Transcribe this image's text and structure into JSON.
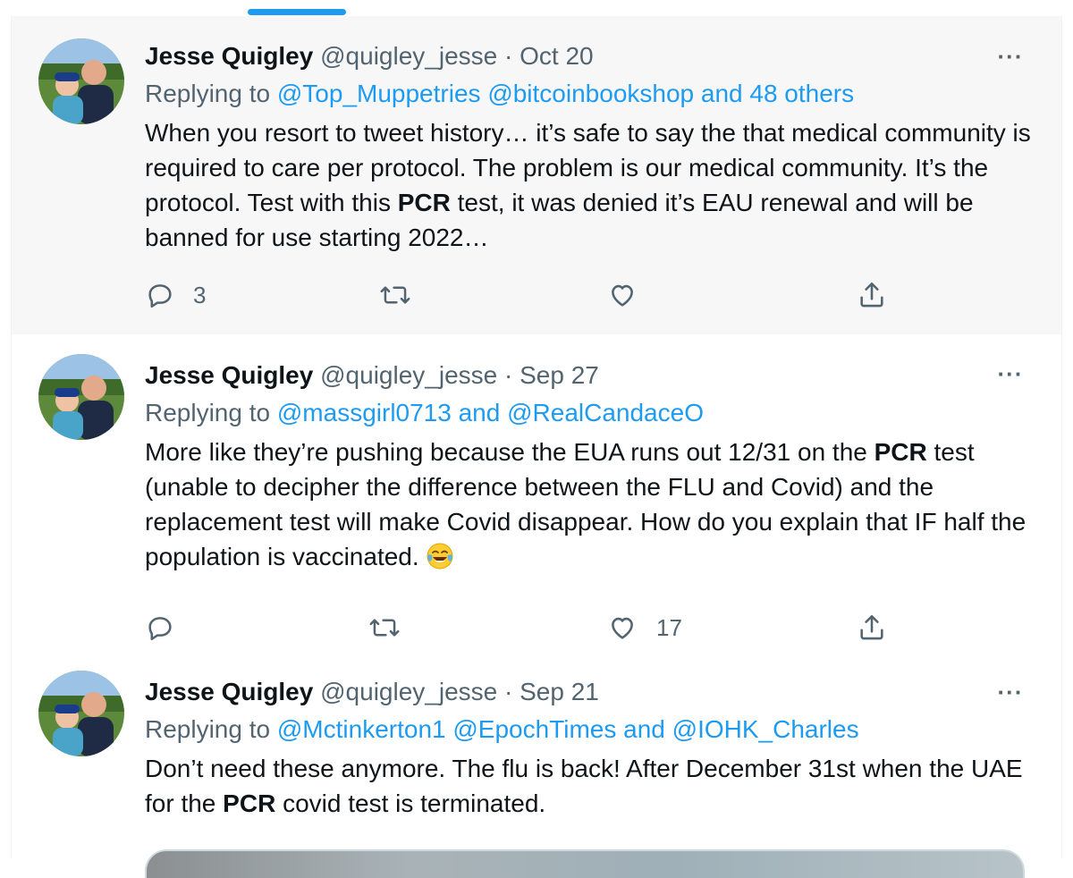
{
  "colors": {
    "accent": "#1d9bf0",
    "secondary_text": "#536471",
    "text": "#0f1419",
    "highlight_bg": "#f7f7f7"
  },
  "tweets": [
    {
      "name": "Jesse Quigley",
      "handle": "@quigley_jesse",
      "sep": "·",
      "date": "Oct 20",
      "replying_prefix": "Replying to",
      "mentions": [
        "@Top_Muppetries",
        "@bitcoinbookshop"
      ],
      "replying_suffix": "and 48 others",
      "text_parts": [
        "When you resort to tweet history… it’s safe to say the that medical community is required to care per protocol. The problem is our medical community. It’s the protocol. Test with this ",
        "PCR",
        " test, it was denied it’s EAU renewal and will be banned for use starting 2022…"
      ],
      "reply_count": "3",
      "retweet_count": "",
      "like_count": ""
    },
    {
      "name": "Jesse Quigley",
      "handle": "@quigley_jesse",
      "sep": "·",
      "date": "Sep 27",
      "replying_prefix": "Replying to",
      "mentions": [
        "@massgirl0713",
        "@RealCandaceO"
      ],
      "replying_joiner": "and",
      "text_parts": [
        "More like they’re pushing because the EUA runs out 12/31 on the ",
        "PCR",
        " test (unable to decipher the difference between the FLU and Covid) and the replacement test will make Covid disappear. How do you explain that IF half the population is vaccinated. "
      ],
      "emoji": "face-with-tears-of-joy",
      "reply_count": "",
      "retweet_count": "",
      "like_count": "17"
    },
    {
      "name": "Jesse Quigley",
      "handle": "@quigley_jesse",
      "sep": "·",
      "date": "Sep 21",
      "replying_prefix": "Replying to",
      "mentions": [
        "@Mctinkerton1",
        "@EpochTimes",
        "@IOHK_Charles"
      ],
      "replying_joiner": "and",
      "text_parts": [
        "Don’t need these anymore. The flu is back! After December 31st when the UAE for the ",
        "PCR",
        " covid test is terminated."
      ]
    }
  ],
  "icons": {
    "more": "more-icon",
    "reply": "reply-icon",
    "retweet": "retweet-icon",
    "like": "like-icon",
    "share": "share-icon"
  }
}
